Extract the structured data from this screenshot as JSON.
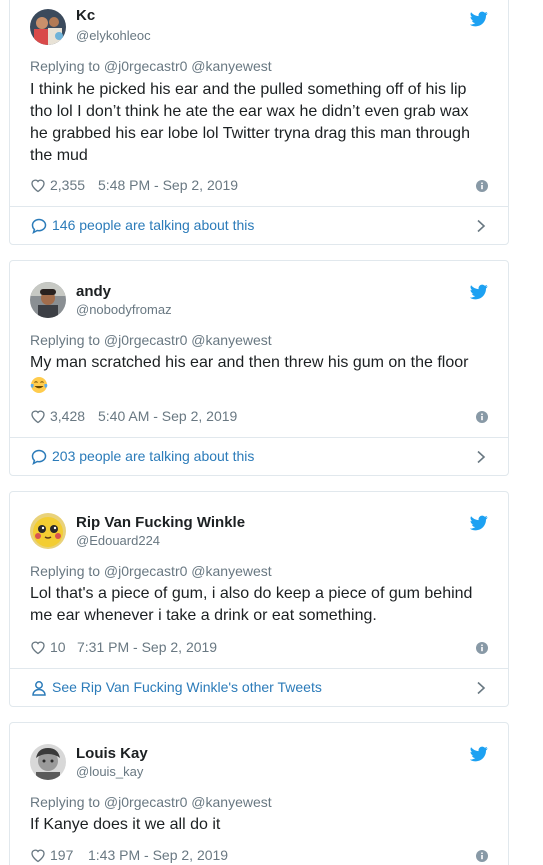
{
  "colors": {
    "link": "#2b7bb9",
    "muted": "#697882",
    "text": "#1c2022",
    "twitter_blue": "#1da1f2",
    "border": "#e1e8ed"
  },
  "tweets": [
    {
      "display_name": "Kc",
      "handle": "@elykohleoc",
      "replying": "Replying to @j0rgecastr0 @kanyewest",
      "text": "I think he picked his ear and the pulled something off of his lip tho lol I don’t think he ate the ear wax he didn’t even grab wax he grabbed his ear lobe lol Twitter tryna drag this man through the mud",
      "likes": "2,355",
      "timestamp": "5:48 PM - Sep 2, 2019",
      "footer": "146 people are talking about this",
      "footer_icon": "speech-bubble-icon"
    },
    {
      "display_name": "andy",
      "handle": "@nobodyfromaz",
      "replying": "Replying to @j0rgecastr0 @kanyewest",
      "text": "My man scratched his ear and then threw his gum on the floor",
      "emoji": "tears-of-joy-emoji",
      "likes": "3,428",
      "timestamp": "5:40 AM - Sep 2, 2019",
      "footer": "203 people are talking about this",
      "footer_icon": "speech-bubble-icon"
    },
    {
      "display_name": "Rip Van Fucking Winkle",
      "handle": "@Edouard224",
      "replying": "Replying to @j0rgecastr0 @kanyewest",
      "text": "Lol that's a piece of gum, i also do keep a piece of gum behind me ear whenever i take a drink or eat something.",
      "likes": "10",
      "timestamp": "7:31 PM - Sep 2, 2019",
      "footer": "See Rip Van Fucking Winkle's other Tweets",
      "footer_icon": "person-icon"
    },
    {
      "display_name": "Louis Kay",
      "handle": "@louis_kay",
      "replying": "Replying to @j0rgecastr0 @kanyewest",
      "text": "If Kanye does it we all do it",
      "likes": "197",
      "timestamp": "1:43 PM - Sep 2, 2019"
    }
  ]
}
